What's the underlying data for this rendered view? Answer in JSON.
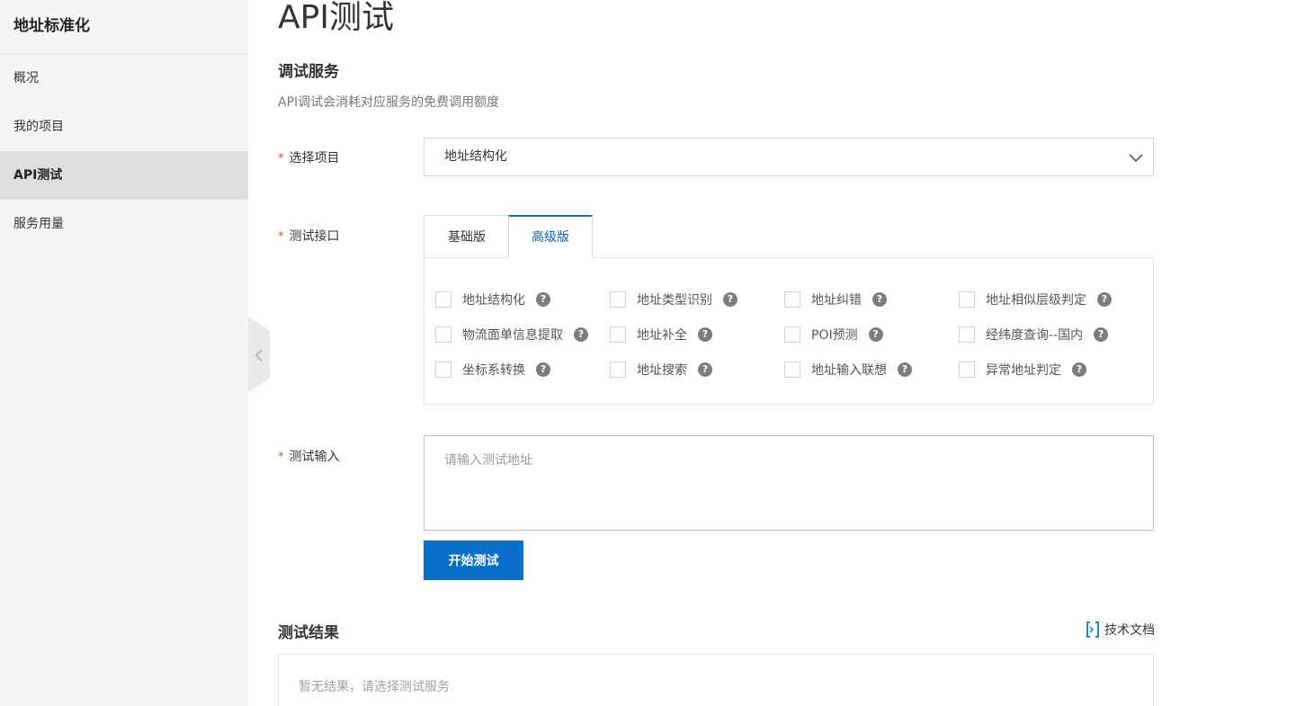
{
  "sidebar": {
    "title": "地址标准化",
    "items": [
      {
        "label": "概况"
      },
      {
        "label": "我的项目"
      },
      {
        "label": "API测试",
        "active": true
      },
      {
        "label": "服务用量"
      }
    ]
  },
  "page": {
    "title": "API测试",
    "section_title": "调试服务",
    "subtitle": "API调试会消耗对应服务的免费调用额度"
  },
  "form": {
    "project": {
      "label": "选择项目",
      "value": "地址结构化"
    },
    "api": {
      "label": "测试接口",
      "tabs": [
        {
          "label": "基础版"
        },
        {
          "label": "高级版",
          "active": true
        }
      ],
      "options": [
        "地址结构化",
        "地址类型识别",
        "地址纠错",
        "地址相似层级判定",
        "物流面单信息提取",
        "地址补全",
        "POI预测",
        "经纬度查询--国内",
        "坐标系转换",
        "地址搜索",
        "地址输入联想",
        "异常地址判定"
      ],
      "help_glyph": "?"
    },
    "input": {
      "label": "测试输入",
      "placeholder": "请输入测试地址"
    },
    "required_mark": "*",
    "submit_label": "开始测试"
  },
  "result": {
    "title": "测试结果",
    "doc_link": "技术文档",
    "empty_text": "暂无结果，请选择测试服务"
  },
  "colors": {
    "primary": "#0a6fc9",
    "tab_active_text": "#0a64b4",
    "required": "#e64a3b",
    "sidebar_bg": "#f5f5f5",
    "sidebar_active_bg": "#dedede"
  },
  "icons": {
    "dropdown": "chevron-down-icon",
    "collapse": "chevron-left-icon",
    "doc": "document-icon",
    "help": "help-icon"
  }
}
